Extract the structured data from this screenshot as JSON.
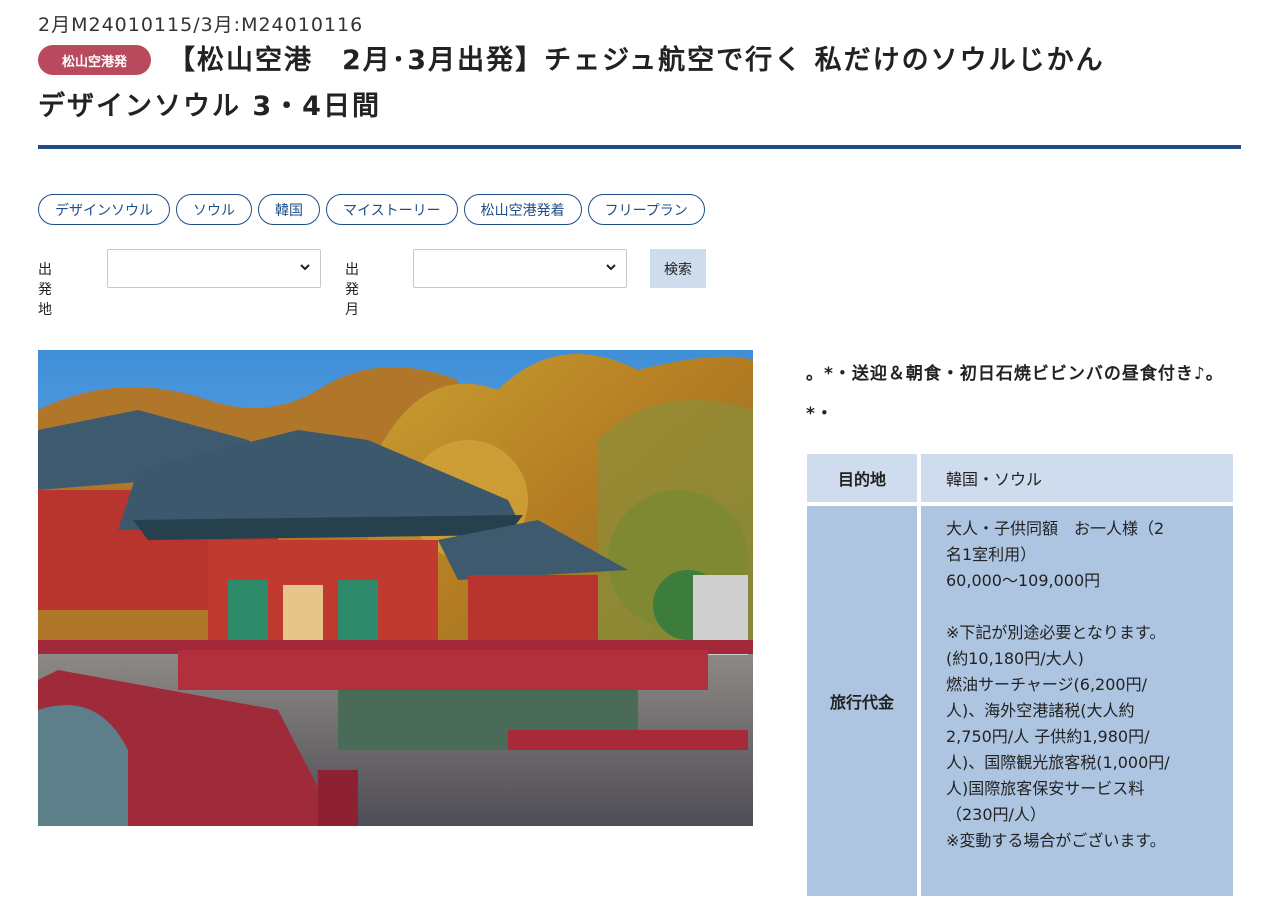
{
  "header": {
    "codes": "2月M24010115/3月:M24010116",
    "badge": "松山空港発",
    "title_line1": "【松山空港　2月･3月出発】チェジュ航空で行く 私だけのソウルじかん",
    "title_line2": "デザインソウル 3・4日間"
  },
  "colors": {
    "accent": "#1f4e87",
    "badge": "#b94a5e",
    "table_light": "#cfdced",
    "table_dark": "#aec5e2"
  },
  "tags": [
    "デザインソウル",
    "ソウル",
    "韓国",
    "マイストーリー",
    "松山空港発着",
    "フリープラン"
  ],
  "search": {
    "departure_label": "出発地",
    "departure_value": "",
    "month_label": "出発月",
    "month_value": "",
    "button_label": "検索"
  },
  "lead": "。*・送迎＆朝食・初日石焼ビビンバの昼食付き♪。*・",
  "info": {
    "destination_label": "目的地",
    "destination_value": "韓国・ソウル",
    "price_label": "旅行代金",
    "price_lines": [
      "大人・子供同額　お一人様（2",
      "名1室利用）",
      "60,000〜109,000円",
      "",
      "※下記が別途必要となります。",
      "(約10,180円/大人)",
      "燃油サーチャージ(6,200円/",
      "人)、海外空港諸税(大人約",
      "2,750円/人 子供約1,980円/",
      "人)、国際観光旅客税(1,000円/",
      "人)国際旅客保安サービス料",
      "（230円/人）",
      "※変動する場合がございます。"
    ]
  }
}
